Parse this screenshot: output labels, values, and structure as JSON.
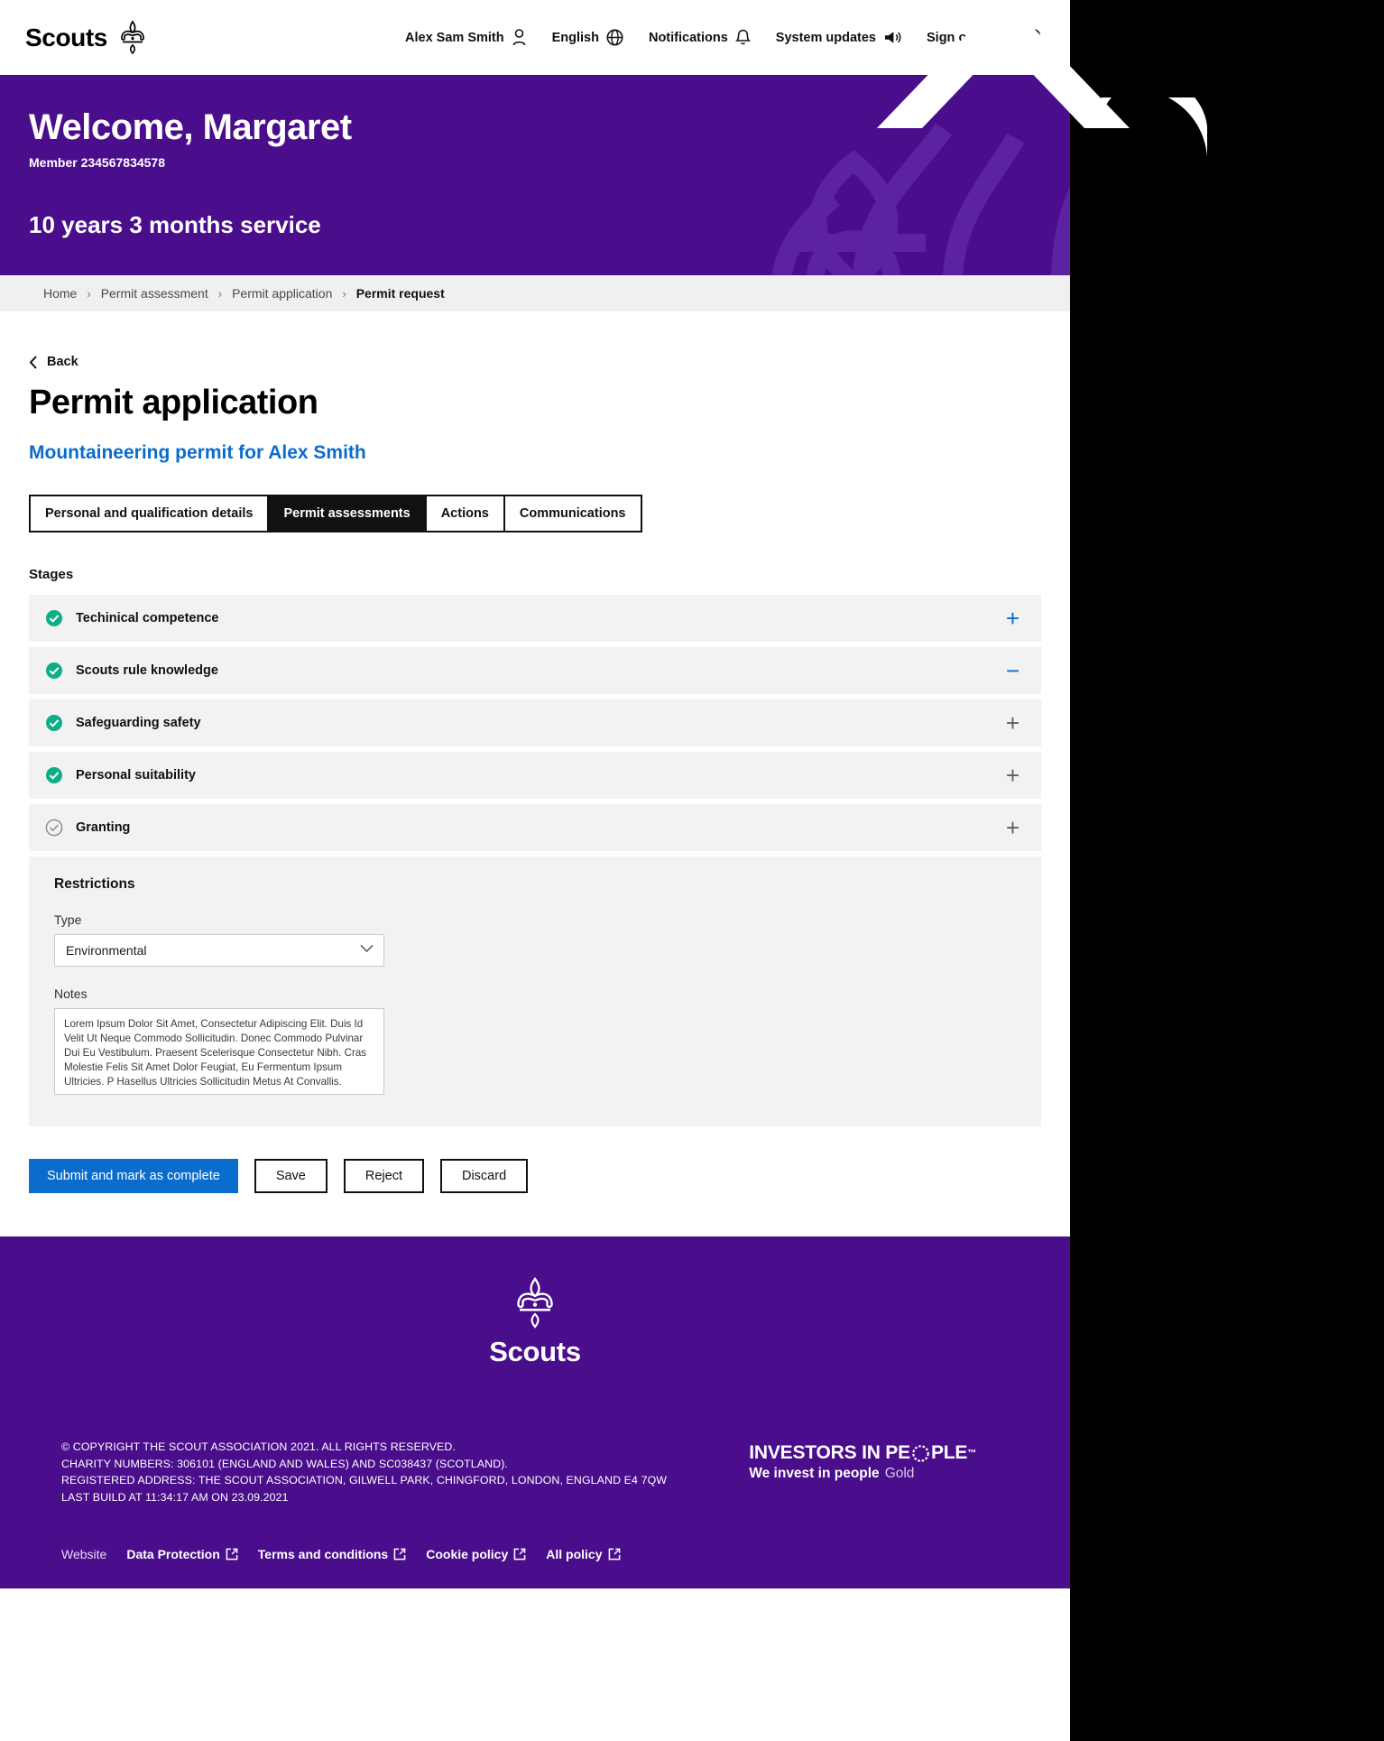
{
  "topnav": {
    "brand": "Scouts",
    "brand_icon": "fleur-de-lis-icon",
    "items": [
      {
        "label": "Alex Sam Smith",
        "icon": "user-icon"
      },
      {
        "label": "English",
        "icon": "globe-icon"
      },
      {
        "label": "Notifications",
        "icon": "bell-icon"
      },
      {
        "label": "System updates",
        "icon": "megaphone-icon"
      },
      {
        "label": "Sign out",
        "icon": "lock-icon"
      }
    ],
    "search_icon": "search-icon"
  },
  "hero": {
    "title": "Welcome, Margaret",
    "member": "Member 234567834578",
    "service": "10 years 3 months service"
  },
  "breadcrumb": {
    "items": [
      "Home",
      "Permit assessment",
      "Permit application",
      "Permit request"
    ],
    "separator": "›"
  },
  "main": {
    "back_label": "Back",
    "back_icon": "chevron-left-icon",
    "title": "Permit application",
    "subtitle": "Mountaineering permit for Alex Smith",
    "tabs": [
      {
        "label": "Personal and qualification details",
        "active": false
      },
      {
        "label": "Permit assessments",
        "active": true
      },
      {
        "label": "Actions",
        "active": false
      },
      {
        "label": "Communications",
        "active": false
      }
    ],
    "stages_label": "Stages",
    "stages": [
      {
        "name": "Techinical competence",
        "status": "complete",
        "toggle": "+",
        "toggle_accent": true
      },
      {
        "name": "Scouts rule knowledge",
        "status": "complete",
        "toggle": "−",
        "toggle_accent": true
      },
      {
        "name": "Safeguarding safety",
        "status": "complete",
        "toggle": "+",
        "toggle_accent": false
      },
      {
        "name": "Personal suitability",
        "status": "complete",
        "toggle": "+",
        "toggle_accent": false
      },
      {
        "name": "Granting",
        "status": "pending",
        "toggle": "+",
        "toggle_accent": false
      }
    ],
    "restrictions": {
      "title": "Restrictions",
      "type_label": "Type",
      "type_value": "Environmental",
      "type_options": [
        "Environmental"
      ],
      "notes_label": "Notes",
      "notes_value": "Lorem Ipsum Dolor Sit Amet, Consectetur Adipiscing Elit. Duis Id Velit Ut Neque Commodo Sollicitudin. Donec Commodo Pulvinar Dui Eu Vestibulum. Praesent Scelerisque Consectetur Nibh. Cras Molestie Felis Sit Amet Dolor Feugiat, Eu Fermentum Ipsum Ultricies. P Hasellus Ultricies Sollicitudin Metus At Convallis."
    },
    "buttons": {
      "submit": "Submit and mark as complete",
      "save": "Save",
      "reject": "Reject",
      "discard": "Discard"
    }
  },
  "footer": {
    "brand": "Scouts",
    "legal": {
      "line1": "© COPYRIGHT THE SCOUT ASSOCIATION 2021. ALL RIGHTS RESERVED.",
      "line2": "CHARITY NUMBERS: 306101 (ENGLAND AND WALES) AND SC038437 (SCOTLAND).",
      "line3": "REGISTERED ADDRESS: THE SCOUT ASSOCIATION, GILWELL PARK, CHINGFORD, LONDON, ENGLAND E4 7QW",
      "line4": "LAST BUILD AT 11:34:17 AM ON 23.09.2021"
    },
    "iip": {
      "part1": "INVESTORS IN PE",
      "part2": "PLE",
      "tm": "™",
      "tagline": "We invest in people",
      "level": "Gold"
    },
    "links": [
      {
        "label": "Website",
        "external": false
      },
      {
        "label": "Data Protection",
        "external": true
      },
      {
        "label": "Terms and conditions",
        "external": true
      },
      {
        "label": "Cookie policy",
        "external": true
      },
      {
        "label": "All policy",
        "external": true
      }
    ]
  },
  "colors": {
    "purple": "#4a0d8c",
    "blue": "#0a6ccd",
    "green": "#0fae86",
    "grey": "#f2f2f2"
  }
}
